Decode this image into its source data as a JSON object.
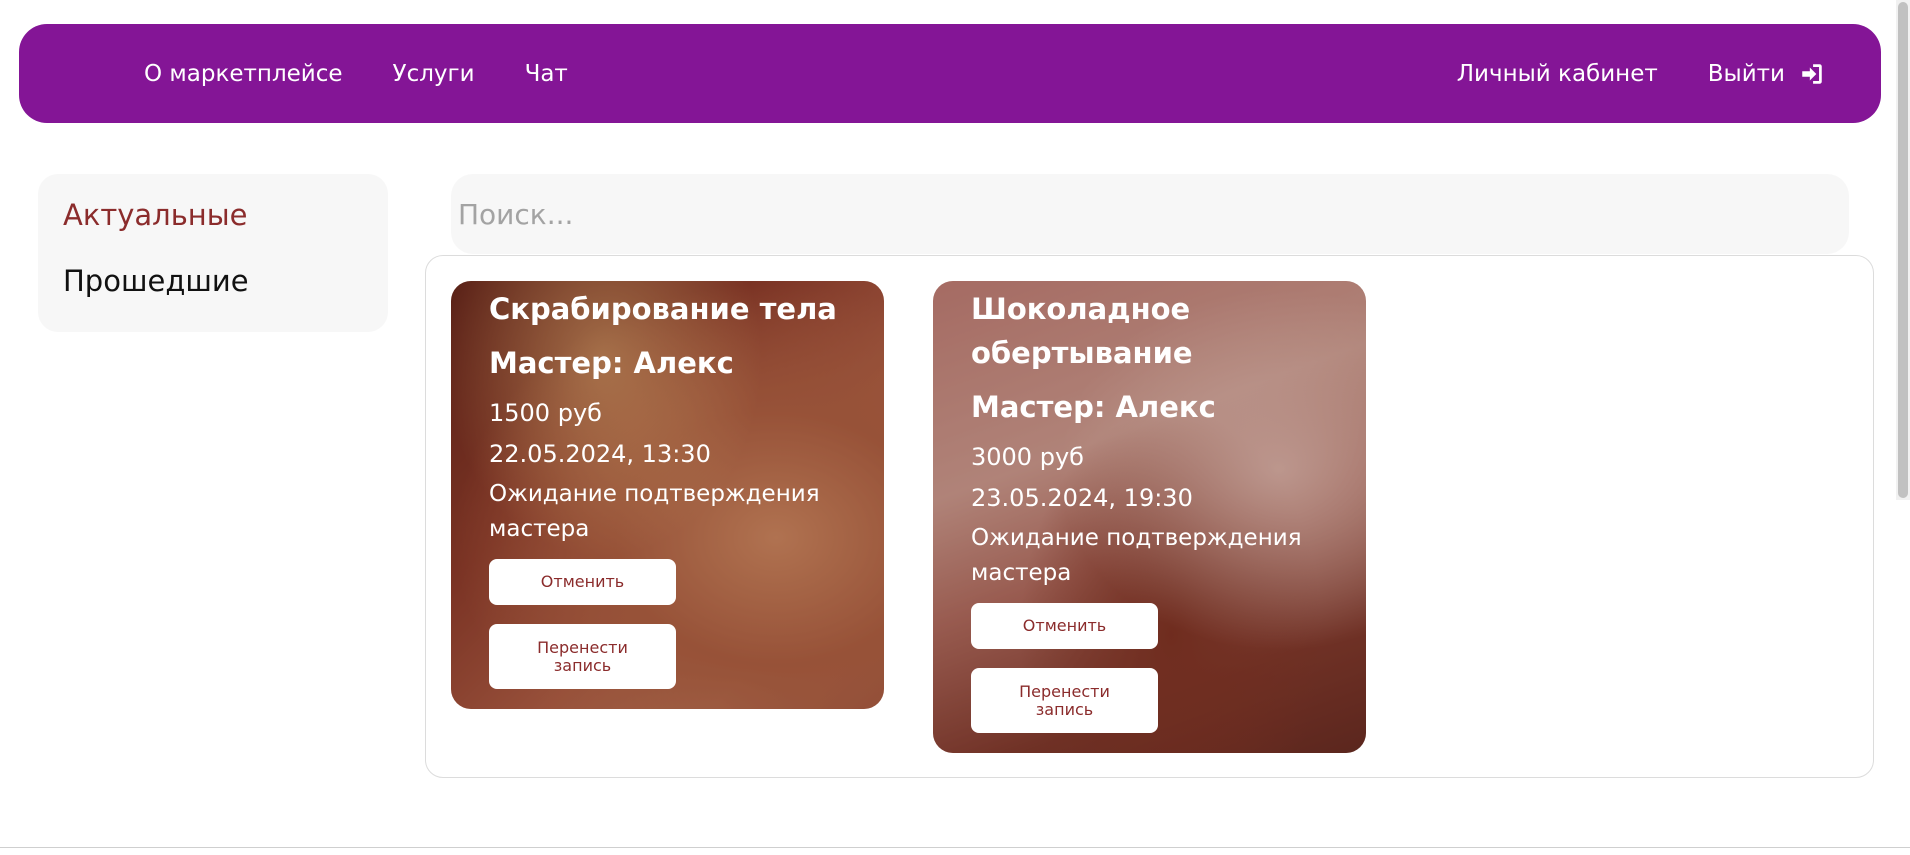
{
  "nav": {
    "left": [
      {
        "label": "О маркетплейсе"
      },
      {
        "label": "Услуги"
      },
      {
        "label": "Чат"
      }
    ],
    "cabinet": "Личный кабинет",
    "logout": "Выйти"
  },
  "sidebar": {
    "items": [
      {
        "label": "Актуальные",
        "active": true
      },
      {
        "label": "Прошедшие",
        "active": false
      }
    ]
  },
  "search": {
    "placeholder": "Поиск..."
  },
  "bookings": [
    {
      "title": "Скрабирование тела",
      "master": "Мастер: Алекс",
      "price": "1500 руб",
      "datetime": "22.05.2024, 13:30",
      "status": "Ожидание подтверждения мастера",
      "cancel_label": "Отменить",
      "move_label": "Перенести запись"
    },
    {
      "title": "Шоколадное обертывание",
      "master": "Мастер: Алекс",
      "price": "3000 руб",
      "datetime": "23.05.2024, 19:30",
      "status": "Ожидание подтверждения мастера",
      "cancel_label": "Отменить",
      "move_label": "Перенести запись"
    }
  ],
  "colors": {
    "navbar": "#841596",
    "accent_text": "#8b2c2c",
    "panel": "#f7f7f7"
  },
  "icons": {
    "logout": "sign-in-arrow-icon"
  }
}
